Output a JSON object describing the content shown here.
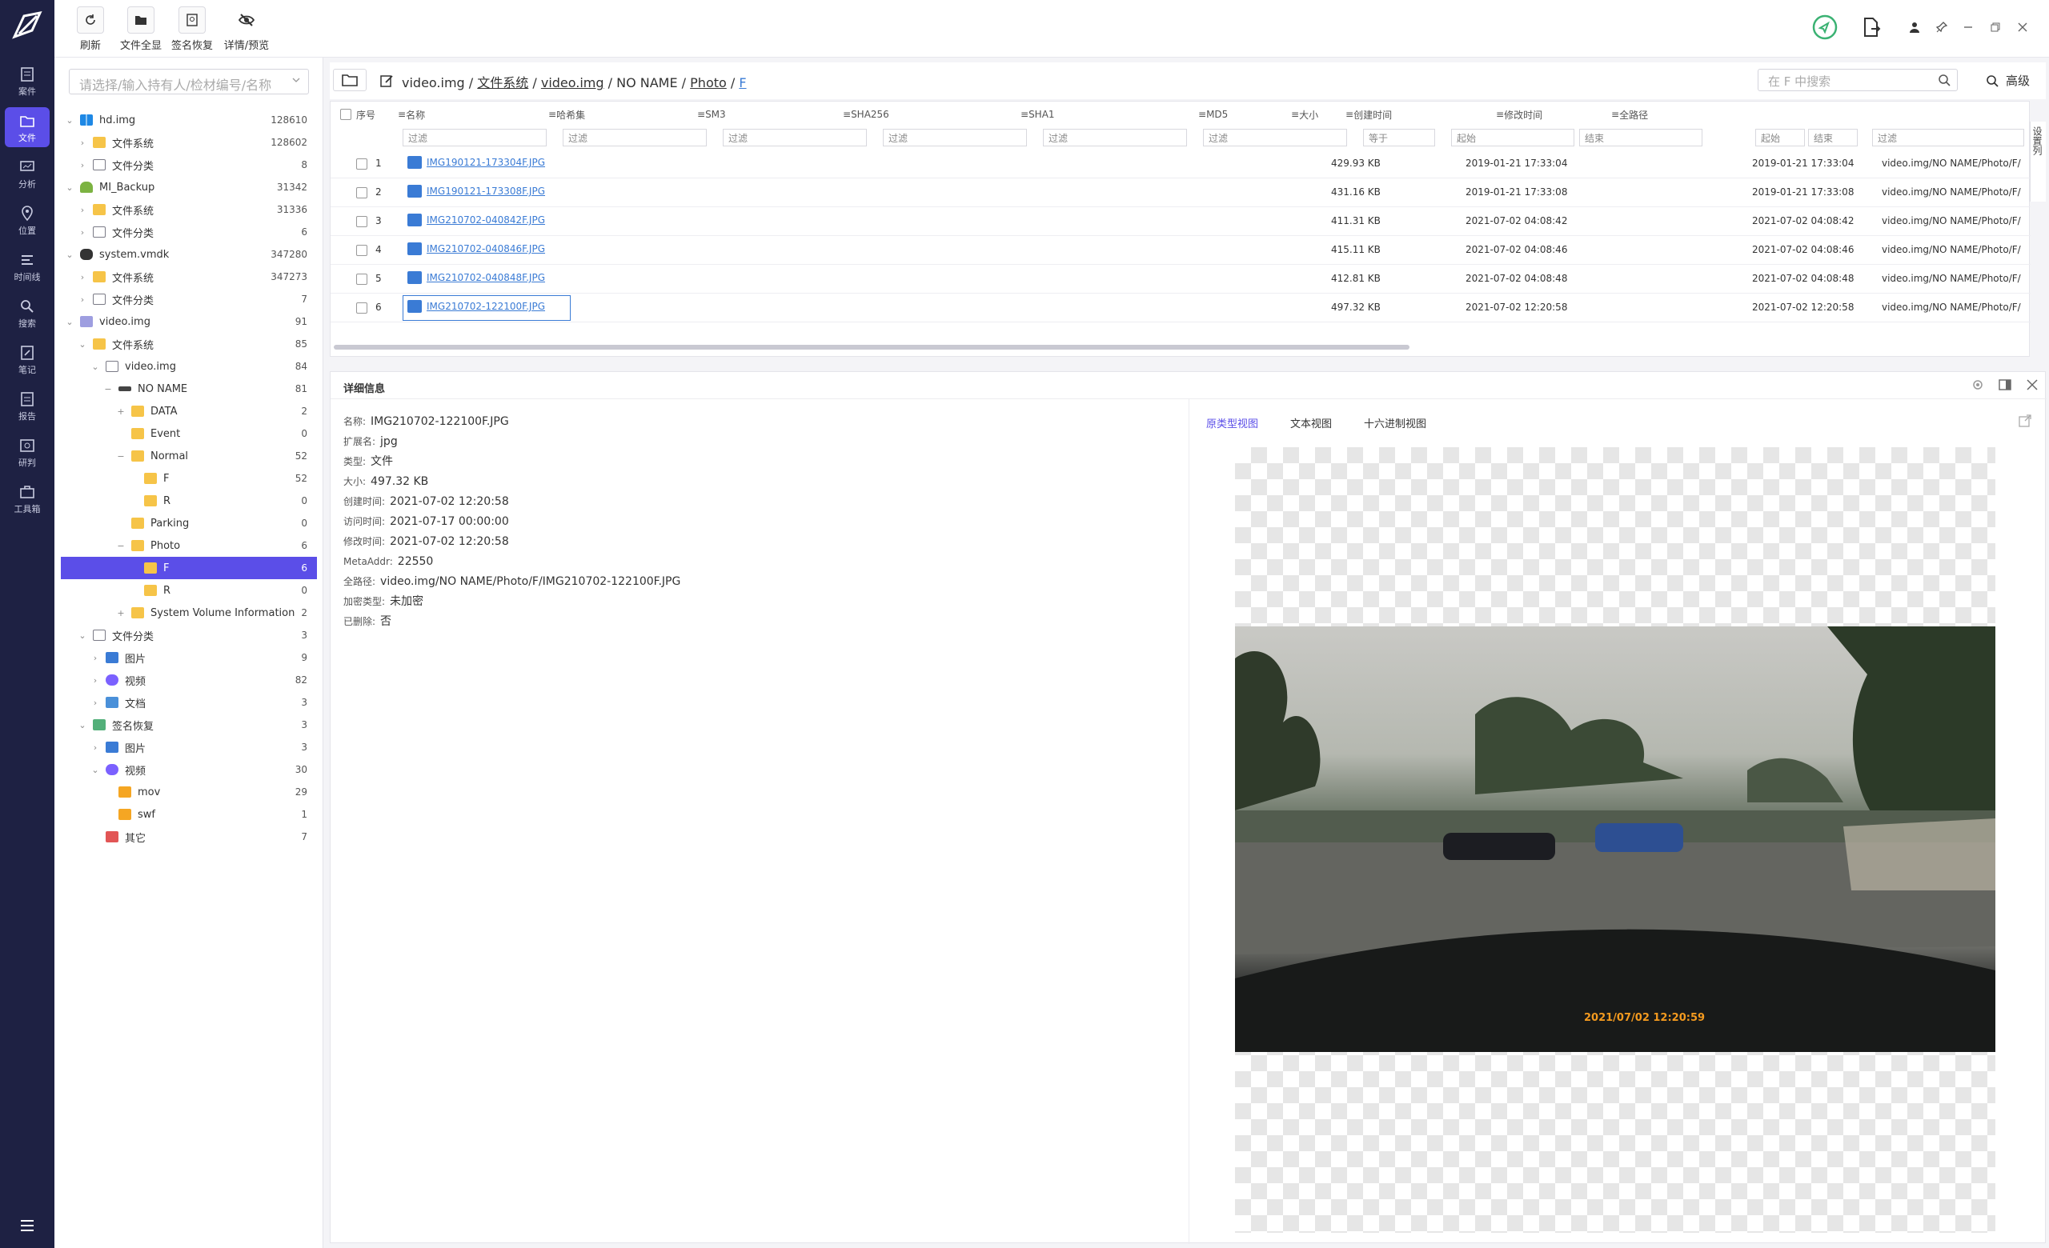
{
  "toolbar": {
    "buttons": [
      {
        "label": "刷新",
        "icon": "refresh-icon"
      },
      {
        "label": "文件全显",
        "icon": "folder-icon"
      },
      {
        "label": "签名恢复",
        "icon": "signature-icon"
      },
      {
        "label": "详情/预览",
        "icon": "eye-off-icon"
      }
    ]
  },
  "nav": {
    "items": [
      {
        "label": "案件",
        "icon": "case-icon"
      },
      {
        "label": "文件",
        "icon": "file-icon",
        "active": true
      },
      {
        "label": "分析",
        "icon": "analysis-icon"
      },
      {
        "label": "位置",
        "icon": "location-icon"
      },
      {
        "label": "时间线",
        "icon": "timeline-icon"
      },
      {
        "label": "搜索",
        "icon": "search-icon"
      },
      {
        "label": "笔记",
        "icon": "note-icon"
      },
      {
        "label": "报告",
        "icon": "report-icon"
      },
      {
        "label": "研判",
        "icon": "judge-icon"
      },
      {
        "label": "工具箱",
        "icon": "toolbox-icon"
      }
    ]
  },
  "tree": {
    "search_placeholder": "请选择/输入持有人/检材编号/名称",
    "rows": [
      {
        "label": "hd.img",
        "count": "128610"
      },
      {
        "label": "文件系统",
        "count": "128602"
      },
      {
        "label": "文件分类",
        "count": "8"
      },
      {
        "label": "MI_Backup",
        "count": "31342"
      },
      {
        "label": "文件系统",
        "count": "31336"
      },
      {
        "label": "文件分类",
        "count": "6"
      },
      {
        "label": "system.vmdk",
        "count": "347280"
      },
      {
        "label": "文件系统",
        "count": "347273"
      },
      {
        "label": "文件分类",
        "count": "7"
      },
      {
        "label": "video.img",
        "count": "91"
      },
      {
        "label": "文件系统",
        "count": "85"
      },
      {
        "label": "video.img",
        "count": "84"
      },
      {
        "label": "NO NAME",
        "count": "81"
      },
      {
        "label": "DATA",
        "count": "2"
      },
      {
        "label": "Event",
        "count": "0"
      },
      {
        "label": "Normal",
        "count": "52"
      },
      {
        "label": "F",
        "count": "52"
      },
      {
        "label": "R",
        "count": "0"
      },
      {
        "label": "Parking",
        "count": "0"
      },
      {
        "label": "Photo",
        "count": "6"
      },
      {
        "label": "F",
        "count": "6"
      },
      {
        "label": "R",
        "count": "0"
      },
      {
        "label": "System Volume Information",
        "count": "2"
      },
      {
        "label": "文件分类",
        "count": "3"
      },
      {
        "label": "图片",
        "count": "9"
      },
      {
        "label": "视频",
        "count": "82"
      },
      {
        "label": "文档",
        "count": "3"
      },
      {
        "label": "签名恢复",
        "count": "3"
      },
      {
        "label": "图片",
        "count": "3"
      },
      {
        "label": "视频",
        "count": "30"
      },
      {
        "label": "mov",
        "count": "29"
      },
      {
        "label": "swf",
        "count": "1"
      },
      {
        "label": "其它",
        "count": "7"
      }
    ]
  },
  "path": {
    "segments": [
      "video.img",
      "文件系统",
      "video.img",
      "NO NAME",
      "Photo",
      "F"
    ],
    "search_placeholder": "在 F 中搜索",
    "advanced": "高级"
  },
  "table": {
    "headers": [
      "序号",
      "名称",
      "哈希集",
      "SM3",
      "SHA256",
      "SHA1",
      "MD5",
      "大小",
      "创建时间",
      "修改时间",
      "全路径"
    ],
    "filter_placeholder": "过滤",
    "size_op": "等于",
    "start": "起始",
    "end": "结束",
    "side_tab": "设置列",
    "rows": [
      {
        "n": "1",
        "name": "IMG190121-173304F.JPG",
        "size": "429.93 KB",
        "ctime": "2019-01-21 17:33:04",
        "mtime": "2019-01-21 17:33:04",
        "path": "video.img/NO NAME/Photo/F/"
      },
      {
        "n": "2",
        "name": "IMG190121-173308F.JPG",
        "size": "431.16 KB",
        "ctime": "2019-01-21 17:33:08",
        "mtime": "2019-01-21 17:33:08",
        "path": "video.img/NO NAME/Photo/F/"
      },
      {
        "n": "3",
        "name": "IMG210702-040842F.JPG",
        "size": "411.31 KB",
        "ctime": "2021-07-02 04:08:42",
        "mtime": "2021-07-02 04:08:42",
        "path": "video.img/NO NAME/Photo/F/"
      },
      {
        "n": "4",
        "name": "IMG210702-040846F.JPG",
        "size": "415.11 KB",
        "ctime": "2021-07-02 04:08:46",
        "mtime": "2021-07-02 04:08:46",
        "path": "video.img/NO NAME/Photo/F/"
      },
      {
        "n": "5",
        "name": "IMG210702-040848F.JPG",
        "size": "412.81 KB",
        "ctime": "2021-07-02 04:08:48",
        "mtime": "2021-07-02 04:08:48",
        "path": "video.img/NO NAME/Photo/F/"
      },
      {
        "n": "6",
        "name": "IMG210702-122100F.JPG",
        "size": "497.32 KB",
        "ctime": "2021-07-02 12:20:58",
        "mtime": "2021-07-02 12:20:58",
        "path": "video.img/NO NAME/Photo/F/"
      }
    ]
  },
  "detail": {
    "title": "详细信息",
    "props": [
      {
        "k": "名称:",
        "v": "IMG210702-122100F.JPG"
      },
      {
        "k": "扩展名:",
        "v": "jpg"
      },
      {
        "k": "类型:",
        "v": "文件"
      },
      {
        "k": "大小:",
        "v": "497.32 KB"
      },
      {
        "k": "创建时间:",
        "v": "2021-07-02 12:20:58"
      },
      {
        "k": "访问时间:",
        "v": "2021-07-17 00:00:00"
      },
      {
        "k": "修改时间:",
        "v": "2021-07-02 12:20:58"
      },
      {
        "k": "MetaAddr:",
        "v": "22550"
      },
      {
        "k": "全路径:",
        "v": "video.img/NO NAME/Photo/F/IMG210702-122100F.JPG"
      },
      {
        "k": "加密类型:",
        "v": "未加密"
      },
      {
        "k": "已删除:",
        "v": "否"
      }
    ],
    "tabs": [
      "原类型视图",
      "文本视图",
      "十六进制视图"
    ],
    "photo_stamp": "2021/07/02 12:20:59"
  },
  "colors": {
    "accent": "#5b4ee8",
    "nav_bg": "#1e2143",
    "link": "#3a7bd5"
  }
}
